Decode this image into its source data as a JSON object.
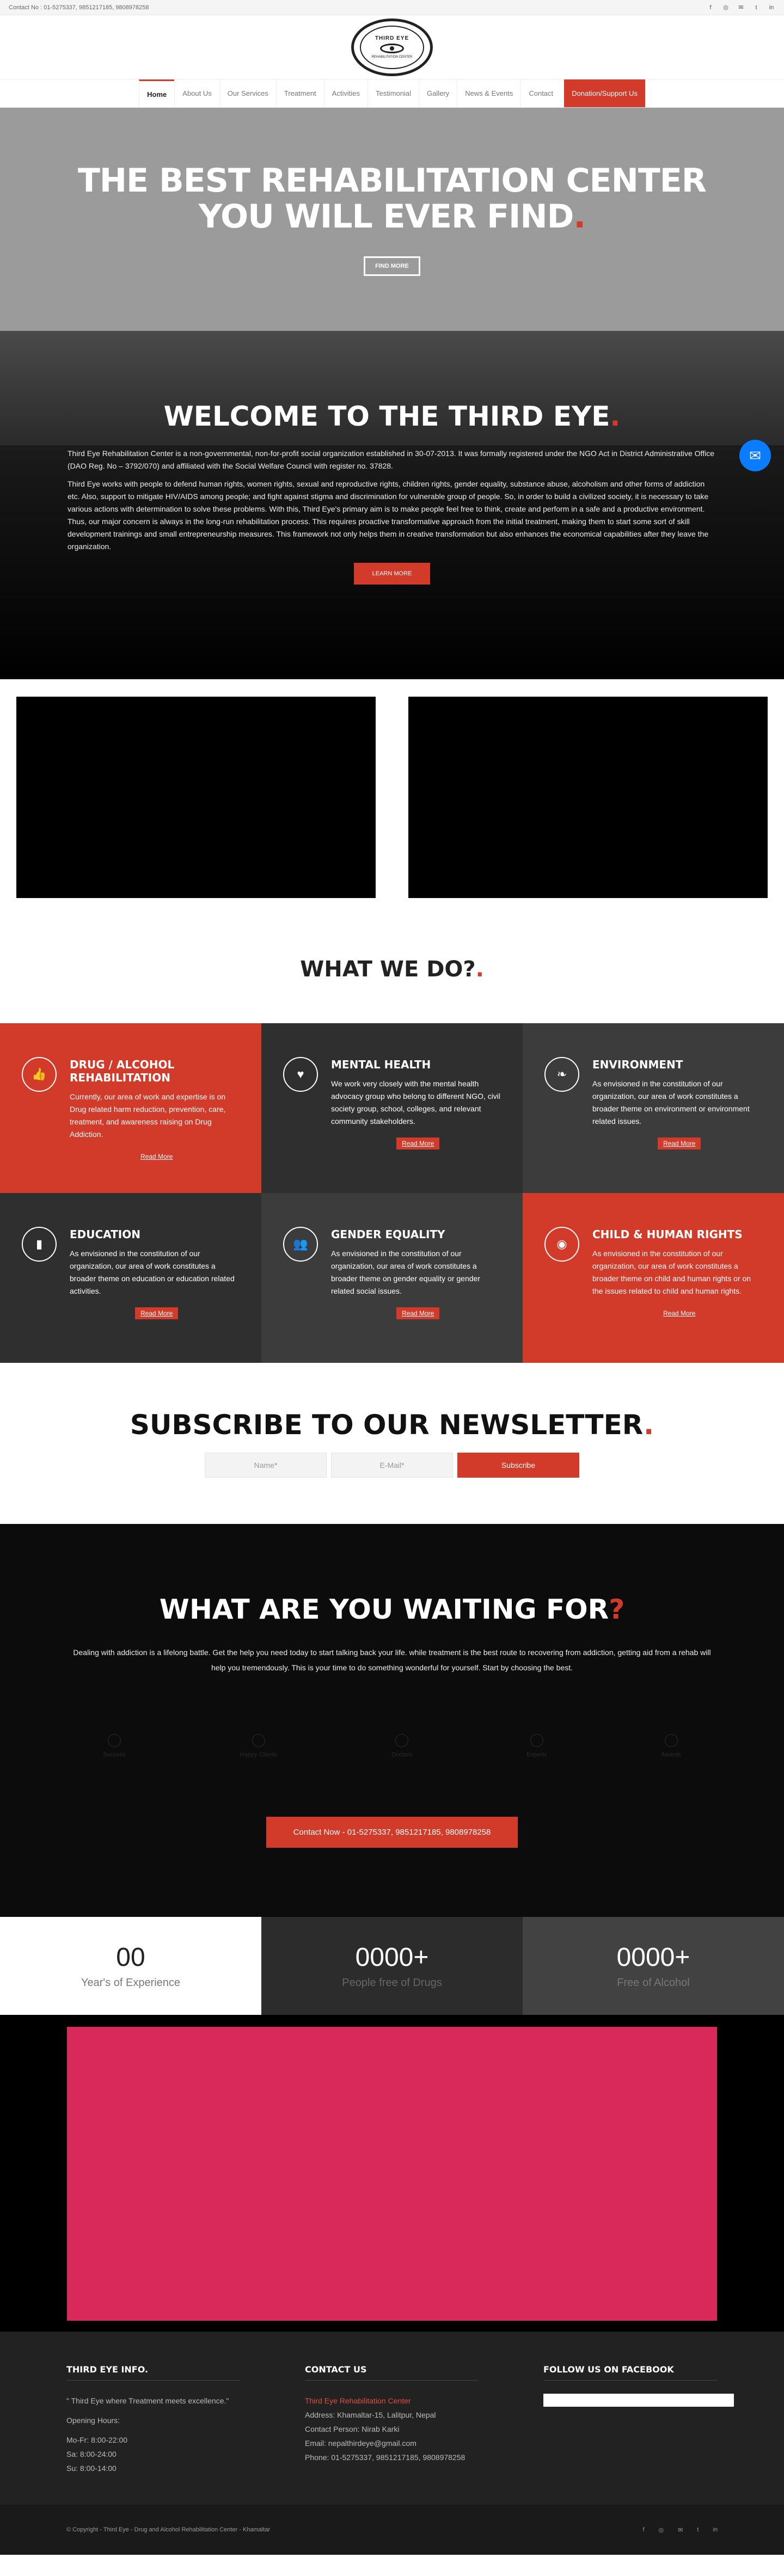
{
  "topbar": {
    "contact": "Contact No : 01-5275337, 9851217185, 9808978258",
    "social": [
      "f",
      "◎",
      "✉",
      "t",
      "in"
    ]
  },
  "logo": {
    "title": "THIRD EYE",
    "bottom": "REHABILITATION CENTER"
  },
  "nav": {
    "items": [
      "Home",
      "About Us",
      "Our Services",
      "Treatment",
      "Activities",
      "Testimonial",
      "Gallery",
      "News & Events",
      "Contact"
    ],
    "donate": "Donation/Support Us"
  },
  "hero": {
    "line1": "THE BEST REHABILITATION CENTER",
    "line2": "YOU WILL EVER FIND",
    "dot": ".",
    "button": "FIND MORE"
  },
  "welcome": {
    "title": "WELCOME TO THE THIRD EYE",
    "dot": ".",
    "p1": "Third Eye Rehabilitation Center is a non-governmental, non-for-profit social organization established in 30-07-2013. It was formally registered under the NGO Act in District Administrative Office (DAO Reg. No – 3792/070) and affiliated with the Social Welfare Council with register no. 37828.",
    "p2": "Third Eye works with people to defend human rights, women rights, sexual and reproductive rights, children rights, gender equality, substance abuse, alcoholism and other forms of addiction etc. Also, support to mitigate HIV/AIDS among people; and fight against stigma and discrimination for vulnerable group of people. So, in order to build a civilized society, it is necessary to take various actions with determination to solve these problems. With this, Third Eye's primary aim is to make people feel free to think, create and perform in a safe and a productive environment. Thus, our major concern is always in the long-run rehabilitation process. This requires proactive transformative approach from the initial treatment, making them to start some sort of skill development trainings and small entrepreneurship measures. This framework not only helps them in creative transformation but also enhances the economical capabilities after they leave the organization.",
    "button": "LEARN MORE"
  },
  "wwd": {
    "title": "WHAT WE DO?",
    "dot": ".",
    "read_more": "Read More",
    "cards": [
      {
        "icon": "👍",
        "title": "DRUG / ALCOHOL REHABILITATION",
        "text": "Currently, our area of work and expertise is on Drug related harm reduction, prevention, care, treatment, and awareness raising on Drug Addiction."
      },
      {
        "icon": "♥",
        "title": "MENTAL HEALTH",
        "text": "We work very closely with the mental health advocacy group who belong to different NGO, civil society group, school, colleges, and relevant community stakeholders."
      },
      {
        "icon": "❧",
        "title": "ENVIRONMENT",
        "text": "As envisioned in the constitution of our organization, our area of work constitutes a broader theme on environment or environment related issues."
      },
      {
        "icon": "▮",
        "title": "EDUCATION",
        "text": "As envisioned in the constitution of our organization, our area of work constitutes a broader theme on education or education related activities."
      },
      {
        "icon": "👥",
        "title": "GENDER EQUALITY",
        "text": "As envisioned in the constitution of our organization, our area of work constitutes a broader theme on gender equality or gender related social issues."
      },
      {
        "icon": "◉",
        "title": "CHILD & HUMAN RIGHTS",
        "text": "As envisioned in the constitution of our organization, our area of work constitutes a broader theme on child and human rights or on the issues related to child and human rights."
      }
    ]
  },
  "newsletter": {
    "title": "SUBSCRIBE TO OUR NEWSLETTER",
    "dot": ".",
    "name_placeholder": "Name*",
    "email_placeholder": "E-Mail*",
    "submit": "Subscribe"
  },
  "waiting": {
    "title": "WHAT ARE YOU WAITING FOR",
    "q": "?",
    "text": "Dealing with addiction is a lifelong battle. Get the help you need today to start talking back your life. while treatment is the best route to recovering from addiction, getting aid from a rehab will help you tremendously. This is your time to do something wonderful for yourself. Start by choosing the best.",
    "faint": [
      "Success",
      "Happy Clients",
      "Doctors",
      "Experts",
      "Awards"
    ],
    "cta": "Contact Now - 01-5275337, 9851217185, 9808978258"
  },
  "counters": [
    {
      "num": "00",
      "label": "Year's of Experience"
    },
    {
      "num": "0000+",
      "label": "People free of Drugs"
    },
    {
      "num": "0000+",
      "label": "Free of Alcohol"
    }
  ],
  "footer": {
    "info_title": "THIRD EYE INFO.",
    "quote": "\" Third Eye where Treatment meets excellence.\"",
    "hours_title": "Opening Hours:",
    "hours": [
      "Mo-Fr: 8:00-22:00",
      "Sa: 8:00-24:00",
      "Su: 8:00-14:00"
    ],
    "contact_title": "CONTACT US",
    "org": "Third Eye Rehabilitation Center",
    "address": "Address: Khamaltar-15, Lalitpur, Nepal",
    "person": "Contact Person: Nirab Karki",
    "email": "Email: nepalthirdeye@gmail.com",
    "phone": "Phone: 01-5275337, 9851217185, 9808978258",
    "fb_title": "FOLLOW US ON FACEBOOK",
    "copyright": "© Copyright - Third Eye - Drug and Alcohol Rehabilitation Center - Khamaltar"
  }
}
